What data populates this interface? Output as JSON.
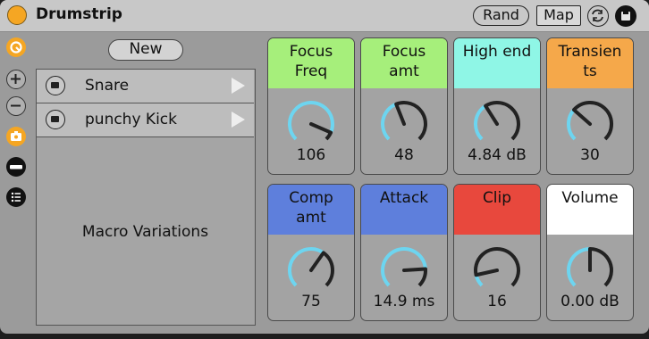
{
  "device": {
    "title": "Drumstrip",
    "rand_label": "Rand",
    "map_label": "Map"
  },
  "colors": {
    "orange": "#f5a623",
    "knob_arc": "#6dd5f0",
    "knob_body": "#222222"
  },
  "sidebar": {
    "icons": [
      "hot-swap-icon",
      "plus-icon",
      "minus-icon",
      "camera-icon",
      "macro-bar-icon",
      "list-icon"
    ]
  },
  "variations": {
    "new_label": "New",
    "items": [
      {
        "label": "Snare"
      },
      {
        "label": "punchy Kick"
      }
    ],
    "section_label": "Macro Variations"
  },
  "macros": [
    {
      "label": "Focus\nFreq",
      "value": "106",
      "color": "#a6ef7b",
      "level": 0.92
    },
    {
      "label": "Focus\namt",
      "value": "48",
      "color": "#a6ef7b",
      "level": 0.42
    },
    {
      "label": "High end",
      "value": "4.84 dB",
      "color": "#8ff6e6",
      "level": 0.38
    },
    {
      "label": "Transien\nts",
      "value": "30",
      "color": "#f5a84a",
      "level": 0.32
    },
    {
      "label": "Comp\namt",
      "value": "75",
      "color": "#5e7fdc",
      "level": 0.63
    },
    {
      "label": "Attack",
      "value": "14.9 ms",
      "color": "#5e7fdc",
      "level": 0.82
    },
    {
      "label": "Clip",
      "value": "16",
      "color": "#e8483d",
      "level": 0.12
    },
    {
      "label": "Volume",
      "value": "0.00 dB",
      "color": "#ffffff",
      "level": 0.5
    }
  ]
}
